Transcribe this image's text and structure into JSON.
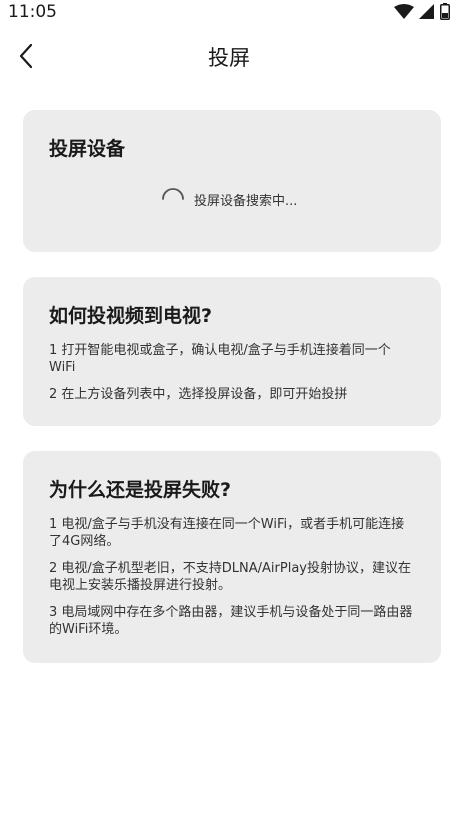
{
  "status_bar": {
    "time": "11:05",
    "icons": [
      "wifi-icon",
      "cellular-signal-icon",
      "battery-icon"
    ]
  },
  "header": {
    "back_icon": "chevron-left-icon",
    "title": "投屏"
  },
  "devices_card": {
    "title": "投屏设备",
    "searching_text": "投屏设备搜索中..."
  },
  "howto_card": {
    "title": "如何投视频到电视?",
    "tips": [
      "1 打开智能电视或盒子，确认电视/盒子与手机连接着同一个WiFi",
      "2 在上方设备列表中，选择投屏设备，即可开始投拼"
    ]
  },
  "fail_card": {
    "title": "为什么还是投屏失败?",
    "tips": [
      "1 电视/盒子与手机没有连接在同一个WiFi，或者手机可能连接了4G网络。",
      "2 电视/盒子机型老旧，不支持DLNA/AirPlay投射协议，建议在电视上安装乐播投屏进行投射。",
      "3 电局域网中存在多个路由器，建议手机与设备处于同一路由器的WiFi环境。"
    ]
  }
}
